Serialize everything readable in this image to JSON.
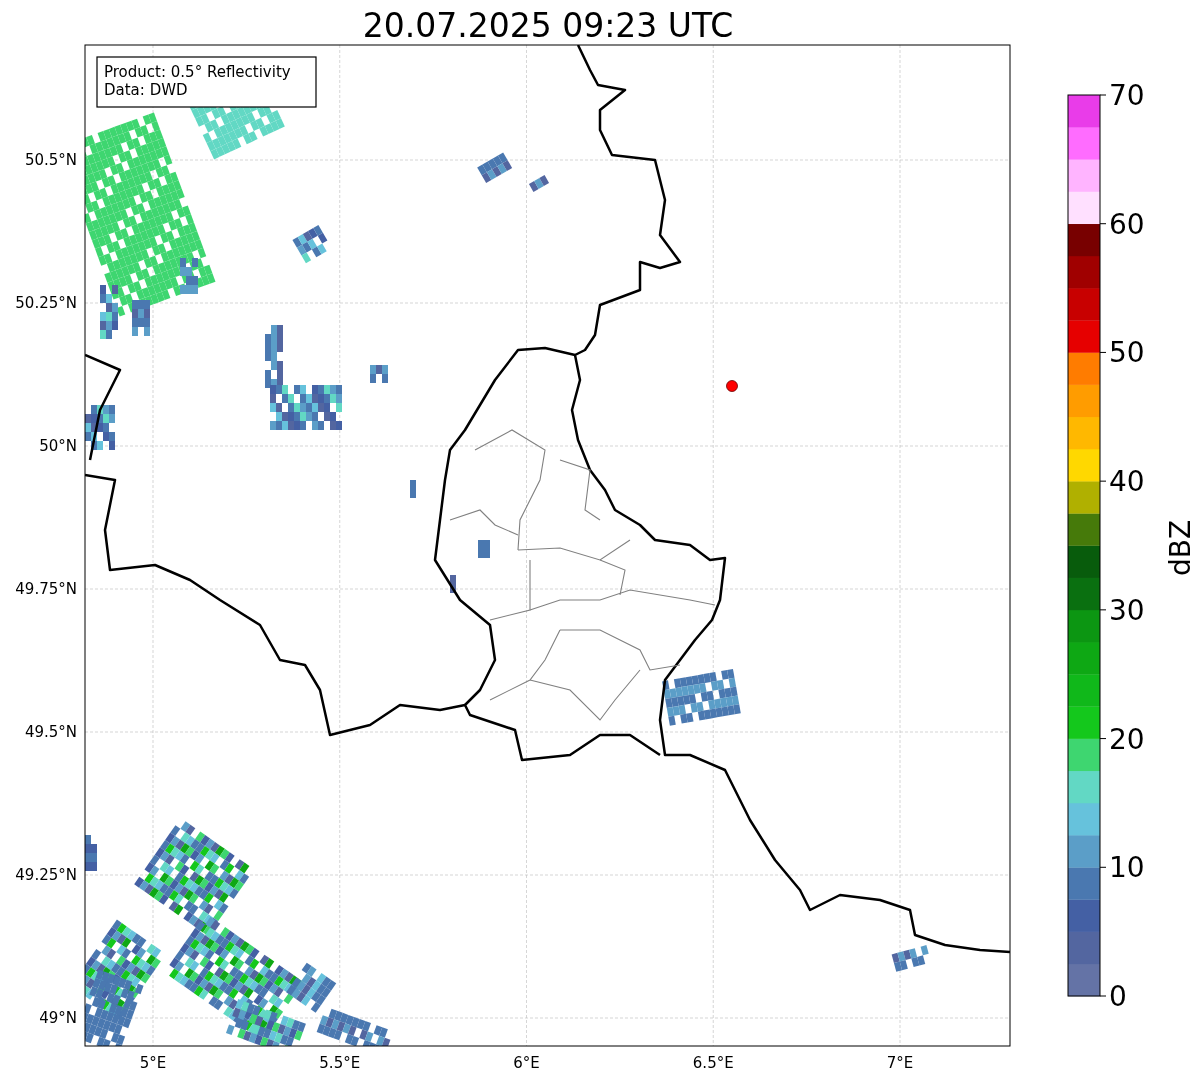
{
  "title": "20.07.2025 09:23 UTC",
  "info_box": {
    "lines": [
      "Product: 0.5° Reflectivity",
      "Data: DWD"
    ]
  },
  "map": {
    "x_ticks": [
      "5°E",
      "5.5°E",
      "6°E",
      "6.5°E",
      "7°E"
    ],
    "y_ticks": [
      "50.5°N",
      "50.25°N",
      "50°N",
      "49.75°N",
      "49.5°N",
      "49.25°N",
      "49°N"
    ]
  },
  "colorbar": {
    "label": "dBZ",
    "ticks": [
      "70",
      "60",
      "50",
      "40",
      "30",
      "20",
      "10",
      "0"
    ],
    "bins": [
      {
        "color": "#6473a6"
      },
      {
        "color": "#5366a0"
      },
      {
        "color": "#4460a4"
      },
      {
        "color": "#4a78b0"
      },
      {
        "color": "#5b9ec8"
      },
      {
        "color": "#66c2dc"
      },
      {
        "color": "#62d8c4"
      },
      {
        "color": "#3ed670"
      },
      {
        "color": "#14c81c"
      },
      {
        "color": "#10b81a"
      },
      {
        "color": "#0ea814"
      },
      {
        "color": "#0c9612"
      },
      {
        "color": "#0a7010"
      },
      {
        "color": "#085c0c"
      },
      {
        "color": "#467a0a"
      },
      {
        "color": "#b0b000"
      },
      {
        "color": "#ffd800"
      },
      {
        "color": "#ffb800"
      },
      {
        "color": "#ff9c00"
      },
      {
        "color": "#ff7c00"
      },
      {
        "color": "#e60000"
      },
      {
        "color": "#c80000"
      },
      {
        "color": "#a00000"
      },
      {
        "color": "#780000"
      },
      {
        "color": "#ffe0ff"
      },
      {
        "color": "#ffb4ff"
      },
      {
        "color": "#ff6cff"
      },
      {
        "color": "#e93ce9"
      }
    ]
  }
}
